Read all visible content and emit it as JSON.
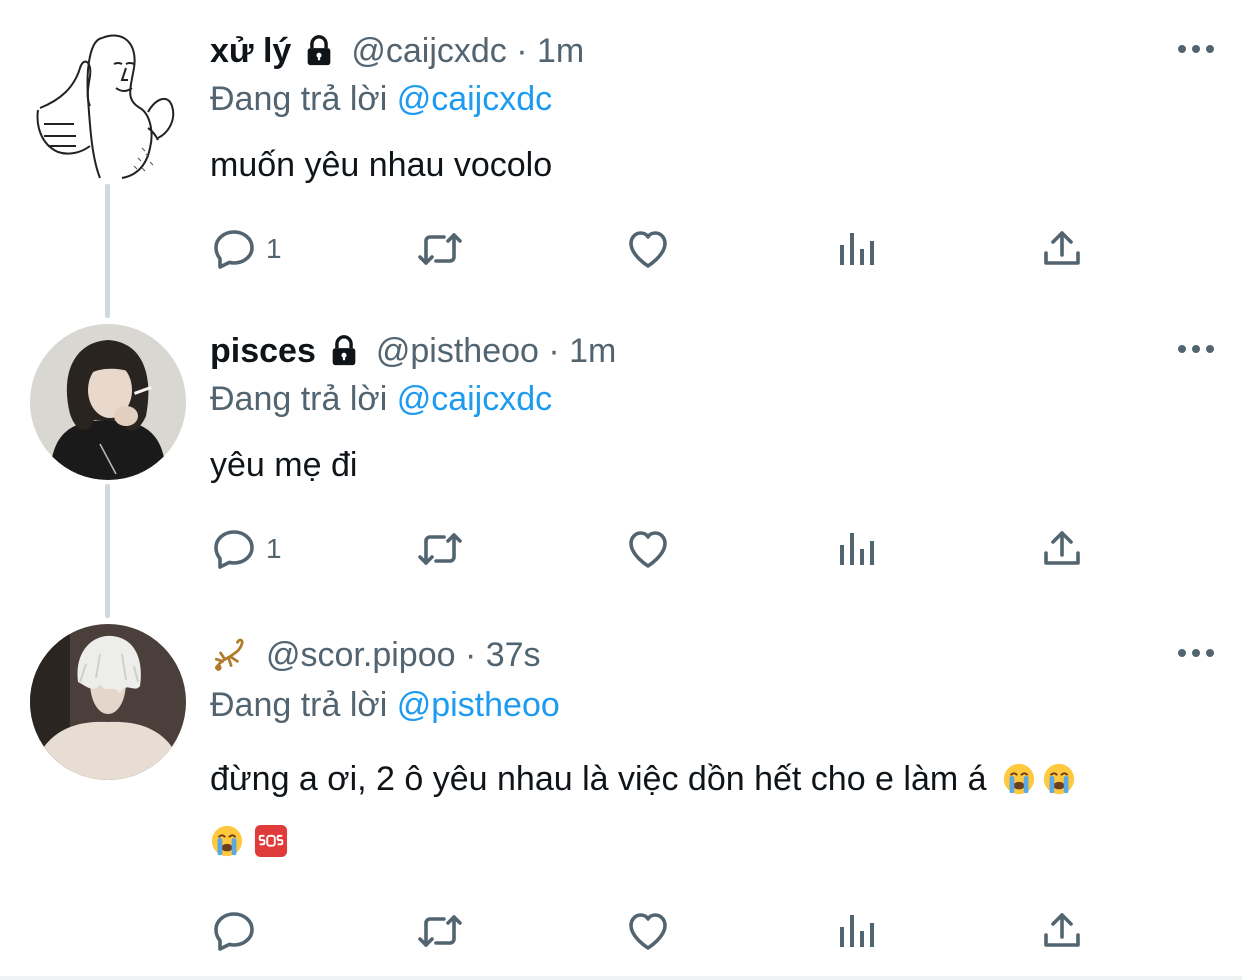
{
  "tweets": [
    {
      "name": "xử lý",
      "protected": true,
      "handle": "@caijcxdc · 1m",
      "replying_prefix": "Đang trả lời ",
      "replying_to": "@caijcxdc",
      "text": "muốn yêu nhau vocolo",
      "reply_count": "1",
      "avatar": "drawn-character-avatar"
    },
    {
      "name": "pisces",
      "protected": true,
      "handle": "@pistheoo · 1m",
      "replying_prefix": "Đang trả lời ",
      "replying_to": "@caijcxdc",
      "text": "yêu mẹ đi",
      "reply_count": "1",
      "avatar": "photo-avatar-smoking"
    },
    {
      "name_emoji": "scorpion-emoji",
      "handle": "@scor.pipoo · 37s",
      "replying_prefix": "Đang trả lời ",
      "replying_to": "@pistheoo",
      "text_line1": "đừng a ơi, 2 ô yêu nhau là việc dồn hết cho e làm á",
      "emojis": [
        "loudly-crying-face",
        "loudly-crying-face",
        "loudly-crying-face",
        "sos-button"
      ],
      "reply_count": "",
      "avatar": "photo-avatar-white-hair"
    }
  ],
  "icons": {
    "reply": "reply-icon",
    "retweet": "retweet-icon",
    "like": "heart-icon",
    "views": "analytics-icon",
    "share": "share-icon",
    "more": "more-icon"
  },
  "colors": {
    "mention": "#1d9bf0",
    "secondary": "#536471",
    "thread_line": "#cfd9de"
  }
}
